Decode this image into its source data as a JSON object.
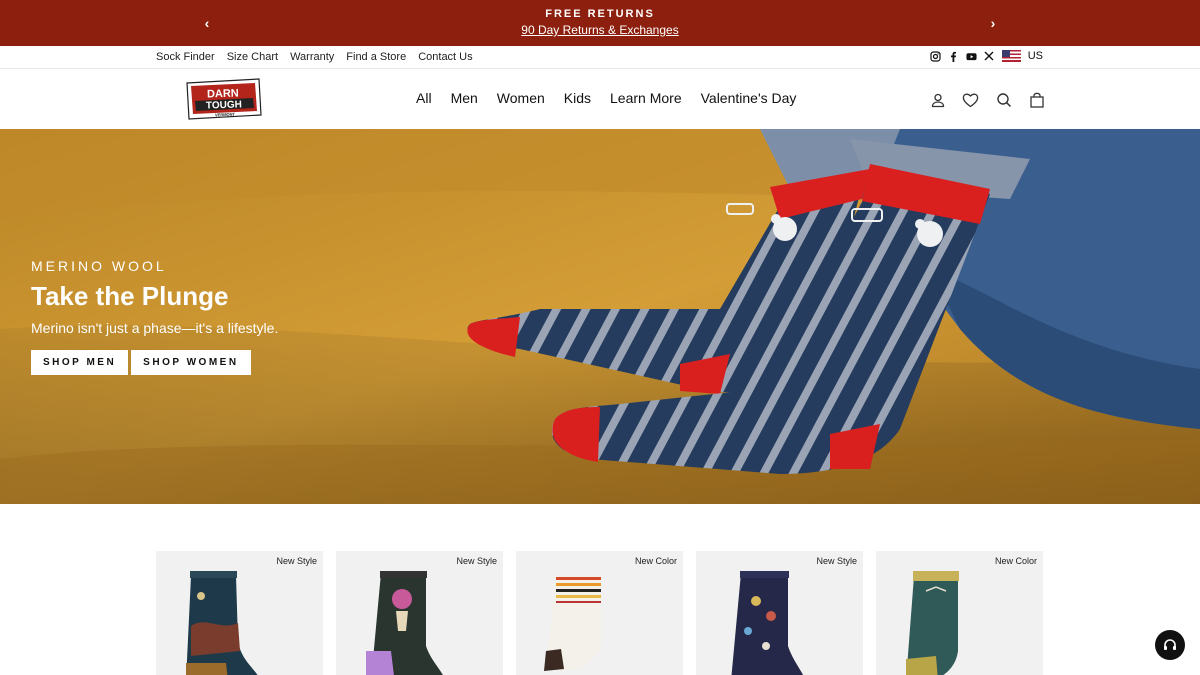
{
  "announcement": {
    "title": "FREE RETURNS",
    "link": "90 Day Returns & Exchanges",
    "prev_icon": "chevron-left-icon",
    "next_icon": "chevron-right-icon"
  },
  "utility": {
    "links": [
      "Sock Finder",
      "Size Chart",
      "Warranty",
      "Find a Store",
      "Contact Us"
    ],
    "social_icons": [
      "instagram-icon",
      "facebook-icon",
      "youtube-icon",
      "x-icon"
    ],
    "country": "US"
  },
  "header": {
    "logo_text": [
      "DARN",
      "TOUGH",
      "VERMONT"
    ],
    "nav": [
      "All",
      "Men",
      "Women",
      "Kids",
      "Learn More",
      "Valentine's Day"
    ],
    "icons": [
      "account-icon",
      "wishlist-heart-icon",
      "search-icon",
      "cart-icon"
    ]
  },
  "hero": {
    "eyebrow": "MERINO WOOL",
    "headline": "Take the Plunge",
    "subhead": "Merino isn't just a phase—it's a lifestyle.",
    "buttons": [
      "SHOP MEN",
      "SHOP WOMEN"
    ]
  },
  "products": [
    {
      "badge": "New Style"
    },
    {
      "badge": "New Style"
    },
    {
      "badge": "New Color"
    },
    {
      "badge": "New Style"
    },
    {
      "badge": "New Color"
    }
  ],
  "colors": {
    "announcement_bg": "#8d1f0e",
    "hero_couch": "#c9922f",
    "sock_navy": "#243a5c",
    "sock_red": "#d9201f"
  }
}
